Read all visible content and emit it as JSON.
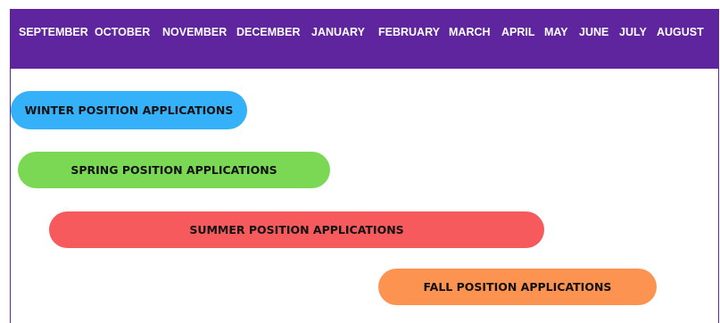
{
  "months": [
    "SEPTEMBER",
    "OCTOBER",
    "NOVEMBER",
    "DECEMBER",
    "JANUARY",
    "FEBRUARY",
    "MARCH",
    "APRIL",
    "MAY",
    "JUNE",
    "JULY",
    "AUGUST"
  ],
  "bars": [
    {
      "label": "WINTER POSITION APPLICATIONS",
      "color": "#35b1fa"
    },
    {
      "label": "SPRING POSITION APPLICATIONS",
      "color": "#7bd855"
    },
    {
      "label": "SUMMER POSITION APPLICATIONS",
      "color": "#f65a5c"
    },
    {
      "label": "FALL POSITION APPLICATIONS",
      "color": "#fd9350"
    }
  ],
  "colors": {
    "header": "#5f259f",
    "frame": "#5c2a9d"
  }
}
